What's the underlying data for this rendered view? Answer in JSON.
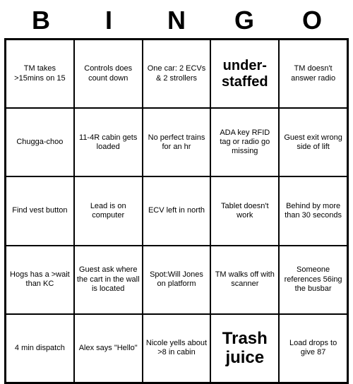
{
  "title": {
    "letters": [
      "B",
      "I",
      "N",
      "G",
      "O"
    ]
  },
  "cells": [
    {
      "text": "TM takes >15mins on 15",
      "size": "normal"
    },
    {
      "text": "Controls does count down",
      "size": "normal"
    },
    {
      "text": "One car: 2 ECVs & 2 strollers",
      "size": "normal"
    },
    {
      "text": "under-staffed",
      "size": "large"
    },
    {
      "text": "TM doesn't answer radio",
      "size": "normal"
    },
    {
      "text": "Chugga-choo",
      "size": "normal"
    },
    {
      "text": "11-4R cabin gets loaded",
      "size": "normal"
    },
    {
      "text": "No perfect trains for an hr",
      "size": "normal"
    },
    {
      "text": "ADA key RFID tag or radio go missing",
      "size": "normal"
    },
    {
      "text": "Guest exit wrong side of lift",
      "size": "normal"
    },
    {
      "text": "Find vest button",
      "size": "normal"
    },
    {
      "text": "Lead is on computer",
      "size": "normal"
    },
    {
      "text": "ECV left in north",
      "size": "normal"
    },
    {
      "text": "Tablet doesn't work",
      "size": "normal"
    },
    {
      "text": "Behind by more than 30 seconds",
      "size": "normal"
    },
    {
      "text": "Hogs has a >wait than KC",
      "size": "normal"
    },
    {
      "text": "Guest ask where the cart in the wall is located",
      "size": "normal"
    },
    {
      "text": "Spot:Will Jones on platform",
      "size": "normal"
    },
    {
      "text": "TM walks off with scanner",
      "size": "normal"
    },
    {
      "text": "Someone references 56ing the busbar",
      "size": "normal"
    },
    {
      "text": "4 min dispatch",
      "size": "normal"
    },
    {
      "text": "Alex says \"Hello\"",
      "size": "normal"
    },
    {
      "text": "Nicole yells about >8 in cabin",
      "size": "normal"
    },
    {
      "text": "Trash juice",
      "size": "xlarge"
    },
    {
      "text": "Load drops to give 87",
      "size": "normal"
    }
  ]
}
